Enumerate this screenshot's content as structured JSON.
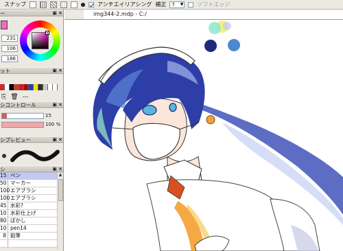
{
  "toolbar": {
    "snap_label": "スナップ",
    "antialias_label": "アンチエイリアシング",
    "antialias_checked": true,
    "correction_label": "補正",
    "correction_value": "7",
    "soft_edge_label": "ソフトエッジ",
    "soft_edge_checked": false
  },
  "color_panel": {
    "title": "ー",
    "primary_color": "#ec6fbf",
    "values": [
      "231",
      "106",
      "186"
    ]
  },
  "palette_panel": {
    "title": "ット",
    "colors": [
      "#d42a2a",
      "#ffffff",
      "#000000",
      "#e03030",
      "#c62020",
      "#a01010",
      "#1d3fbf",
      "#f4e300",
      "#2f2f2f",
      "#c8c8c8",
      "#ffffff",
      "#ffffff"
    ],
    "tools_dash": "---"
  },
  "brush_control": {
    "title": "シコントロール",
    "size_value": "15",
    "size_fraction": 0.12,
    "density_value": "100 %",
    "density_fraction": 1.0
  },
  "brush_preview": {
    "title": "シプレビュー"
  },
  "brush_list": {
    "title": "シ",
    "items": [
      {
        "size": "15",
        "name": "ペン",
        "selected": true
      },
      {
        "size": "50",
        "name": "マーカー",
        "selected": false
      },
      {
        "size": "100",
        "name": "エアブラシ",
        "selected": false
      },
      {
        "size": "100",
        "name": "エアブラシ",
        "selected": false
      },
      {
        "size": "45",
        "name": "水彩?",
        "selected": false
      },
      {
        "size": "10",
        "name": "水彩仕上げ",
        "selected": false
      },
      {
        "size": "80",
        "name": "ぼかし",
        "selected": false
      },
      {
        "size": "10",
        "name": "pen14",
        "selected": false
      },
      {
        "size": "8",
        "name": "鉛筆",
        "selected": false
      },
      {
        "size": "",
        "name": "",
        "selected": false
      }
    ]
  },
  "canvas_window": {
    "title": "img344-2.mdp - C:/"
  }
}
